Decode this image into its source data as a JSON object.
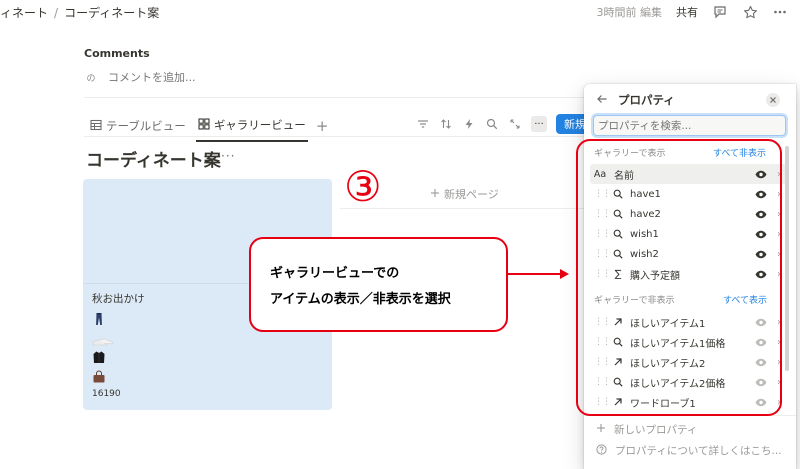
{
  "topbar": {
    "breadcrumb_parent": "ィネート",
    "breadcrumb_separator": "/",
    "breadcrumb_current": "コーディネート案",
    "edited": "3時間前 編集",
    "share": "共有"
  },
  "comments": {
    "title": "Comments",
    "avatar": "の",
    "placeholder": "コメントを追加..."
  },
  "views": {
    "tabs": [
      {
        "label": "テーブルビュー",
        "icon": "table-icon"
      },
      {
        "label": "ギャラリービュー",
        "icon": "gallery-icon"
      }
    ],
    "new_label": "新規"
  },
  "database": {
    "title": "コーディネート案",
    "more": "···",
    "new_page": "新規ページ"
  },
  "card": {
    "title": "秋お出かけ",
    "items": [
      "jeans-icon",
      "sneakers-icon",
      "jacket-icon",
      "bag-icon"
    ],
    "price": "16190"
  },
  "annotation": {
    "step": "③",
    "line1": "ギャラリービューでの",
    "line2": "アイテムの表示／非表示を選択"
  },
  "panel": {
    "title": "プロパティ",
    "search_placeholder": "プロパティを検索...",
    "shown_label": "ギャラリーで表示",
    "shown_action": "すべて非表示",
    "hidden_label": "ギャラリーで非表示",
    "hidden_action": "すべて表示",
    "title_type": "Aa",
    "shown": [
      {
        "name": "名前",
        "type": "title"
      },
      {
        "name": "have1",
        "type": "search"
      },
      {
        "name": "have2",
        "type": "search"
      },
      {
        "name": "wish1",
        "type": "search"
      },
      {
        "name": "wish2",
        "type": "search"
      },
      {
        "name": "購入予定額",
        "type": "sum"
      }
    ],
    "hidden": [
      {
        "name": "ほしいアイテム1",
        "type": "relation"
      },
      {
        "name": "ほしいアイテム1価格",
        "type": "search"
      },
      {
        "name": "ほしいアイテム2",
        "type": "relation"
      },
      {
        "name": "ほしいアイテム2価格",
        "type": "search"
      },
      {
        "name": "ワードローブ1",
        "type": "relation"
      }
    ],
    "new_property": "新しいプロパティ",
    "learn_more": "プロパティについて詳しくはこち..."
  },
  "colors": {
    "accent": "#2383e2",
    "annotation_red": "#e60012",
    "card_bg": "#dce9f7"
  }
}
